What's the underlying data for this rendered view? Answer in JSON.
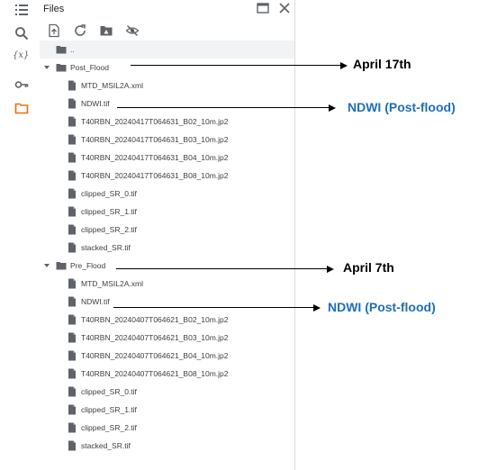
{
  "panel": {
    "title": "Files"
  },
  "icons": {
    "rail": [
      "list-icon",
      "search-icon",
      "variables-icon",
      "key-icon",
      "folder-icon"
    ],
    "toolbar": [
      "upload-icon",
      "refresh-icon",
      "drive-icon",
      "hide-icon"
    ],
    "header": [
      "open-in-new-window-icon",
      "close-icon"
    ]
  },
  "rail": {
    "variables_label": "{x}"
  },
  "tree": {
    "parent_label": "..",
    "post_flood": {
      "folder": "Post_Flood",
      "files": [
        "MTD_MSIL2A.xml",
        "NDWI.tif",
        "T40RBN_20240417T064631_B02_10m.jp2",
        "T40RBN_20240417T064631_B03_10m.jp2",
        "T40RBN_20240417T064631_B04_10m.jp2",
        "T40RBN_20240417T064631_B08_10m.jp2",
        "clipped_SR_0.tif",
        "clipped_SR_1.tif",
        "clipped_SR_2.tif",
        "stacked_SR.tif"
      ]
    },
    "pre_flood": {
      "folder": "Pre_Flood",
      "files": [
        "MTD_MSIL2A.xml",
        "NDWI.tif",
        "T40RBN_20240407T064621_B02_10m.jp2",
        "T40RBN_20240407T064621_B03_10m.jp2",
        "T40RBN_20240407T064621_B04_10m.jp2",
        "T40RBN_20240407T064621_B08_10m.jp2",
        "clipped_SR_0.tif",
        "clipped_SR_1.tif",
        "clipped_SR_2.tif",
        "stacked_SR.tif"
      ]
    }
  },
  "annotations": {
    "post_date": "April 17th",
    "post_ndwi": "NDWI (Post-flood)",
    "pre_date": "April 7th",
    "pre_ndwi": "NDWI (Post-flood)"
  },
  "colors": {
    "annotation_blue": "#1f6fb3",
    "selected_row": "#f1f3f4",
    "icon_grey": "#5f6368",
    "folder_orange": "#e8710a"
  }
}
